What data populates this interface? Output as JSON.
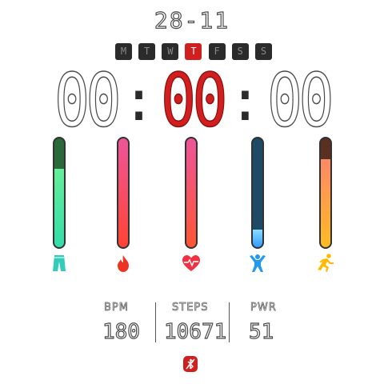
{
  "date": "28-11",
  "weekdays": [
    {
      "label": "M",
      "active": false
    },
    {
      "label": "T",
      "active": false
    },
    {
      "label": "W",
      "active": false
    },
    {
      "label": "T",
      "active": true
    },
    {
      "label": "F",
      "active": false
    },
    {
      "label": "S",
      "active": false
    },
    {
      "label": "S",
      "active": false
    }
  ],
  "time": {
    "hours": "00",
    "minutes": "00",
    "seconds": "00"
  },
  "bars": [
    {
      "name": "distance",
      "fill_fraction": 0.72,
      "fill_color_top": "#66ee99",
      "fill_color_bottom": "#33ddaa",
      "empty_color": "#2a6a3a",
      "icon": "pants-icon",
      "icon_color": "#33ccbb"
    },
    {
      "name": "calories",
      "fill_fraction": 1.0,
      "fill_color_top": "#ee5599",
      "fill_color_bottom": "#ff4433",
      "empty_color": "#a02040",
      "icon": "flame-icon",
      "icon_color": "#ee3322"
    },
    {
      "name": "heart-rate",
      "fill_fraction": 1.0,
      "fill_color_top": "#ee5599",
      "fill_color_bottom": "#ff5533",
      "empty_color": "#a02040",
      "icon": "heart-pulse-icon",
      "icon_color": "#ee3344"
    },
    {
      "name": "activity",
      "fill_fraction": 0.16,
      "fill_color_top": "#88ddff",
      "fill_color_bottom": "#3399ff",
      "empty_color": "#1e4a66",
      "icon": "person-arms-up-icon",
      "icon_color": "#2299ee"
    },
    {
      "name": "running",
      "fill_fraction": 0.81,
      "fill_color_top": "#ff8866",
      "fill_color_bottom": "#ffbb22",
      "empty_color": "#5a3020",
      "icon": "runner-icon",
      "icon_color": "#ffbb00"
    }
  ],
  "stats": {
    "bpm": {
      "label": "BPM",
      "value": "180"
    },
    "steps": {
      "label": "STEPS",
      "value": "10671"
    },
    "pwr": {
      "label": "PWR",
      "value": "51"
    }
  },
  "colors": {
    "accent": "#d11f1f",
    "outline": "#4a4a4a",
    "weekday_bg": "#2b2b2b"
  },
  "bottom_icon": "phone-disconnected-icon"
}
